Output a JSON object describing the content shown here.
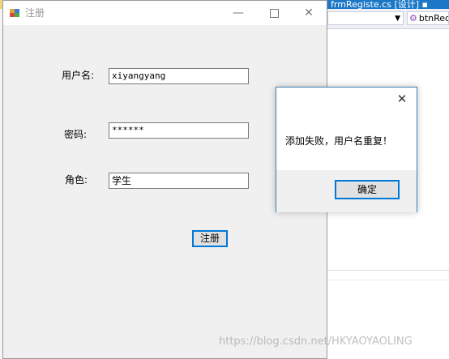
{
  "ide": {
    "tab_label": "frmRegiste.cs [设计]",
    "member_dropdown": "btnRec",
    "member_icon": "method-icon"
  },
  "form": {
    "title": "注册",
    "window_icon": "app-icon",
    "username_label": "用户名:",
    "username_value": "xiyangyang",
    "password_label": "密码:",
    "password_value": "******",
    "role_label": "角色:",
    "role_value": "学生",
    "register_button": "注册"
  },
  "message_box": {
    "text": "添加失败，用户名重复！",
    "ok_button": "确定"
  },
  "watermark": "https://blog.csdn.net/HKYAOYAOLING",
  "colors": {
    "accent": "#0078d7",
    "ide_tab": "#1c78c6",
    "ide_bar": "#ecd87a"
  }
}
